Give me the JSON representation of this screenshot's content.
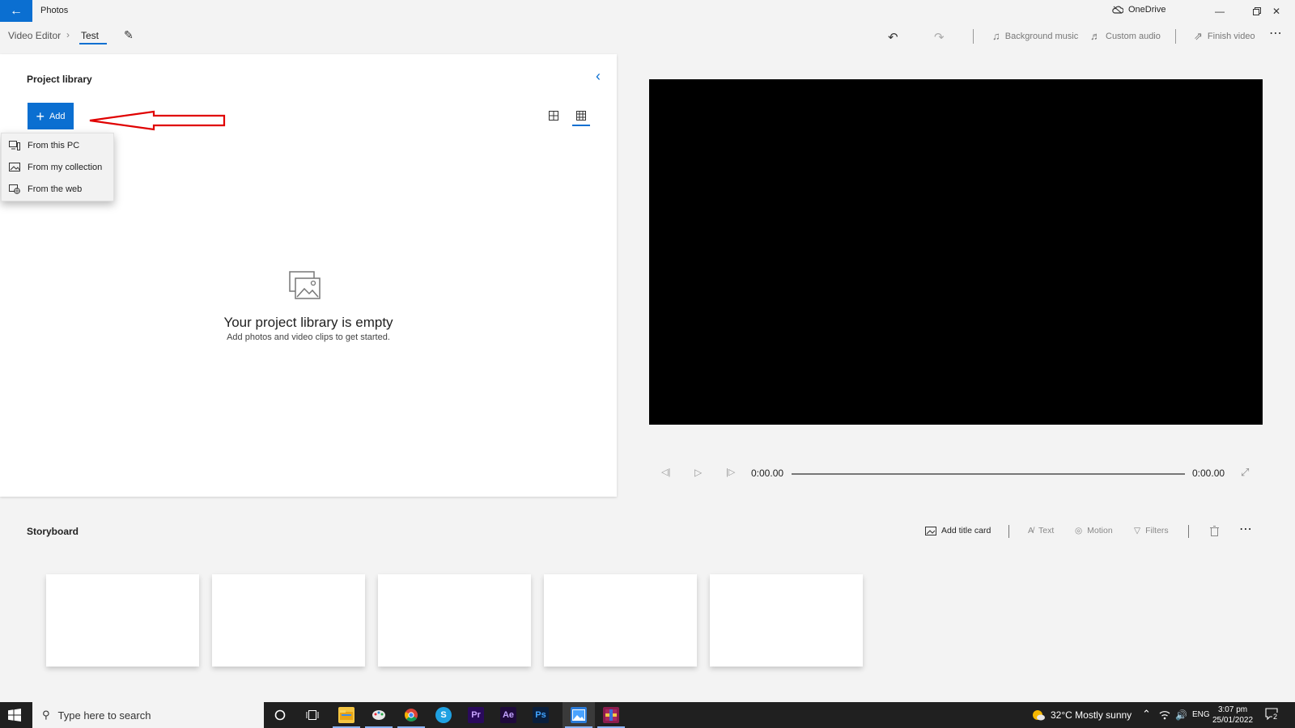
{
  "titlebar": {
    "app_title": "Photos",
    "onedrive_label": "OneDrive",
    "back_icon": "back-arrow-icon",
    "accent_color": "#0b6fd1"
  },
  "cmdbar": {
    "breadcrumb_root": "Video Editor",
    "breadcrumb_current": "Test",
    "tools": {
      "background_music": "Background music",
      "custom_audio": "Custom audio",
      "finish_video": "Finish video"
    }
  },
  "library": {
    "title": "Project library",
    "add_label": "Add",
    "menu": [
      {
        "label": "From this PC",
        "icon": "pc-icon"
      },
      {
        "label": "From my collection",
        "icon": "collection-icon"
      },
      {
        "label": "From the web",
        "icon": "web-icon"
      }
    ],
    "empty_title": "Your project library is empty",
    "empty_subtitle": "Add photos and video clips to get started."
  },
  "player": {
    "current_time": "0:00.00",
    "total_time": "0:00.00",
    "progress_fraction": 0
  },
  "storyboard": {
    "title": "Storyboard",
    "add_title_card": "Add title card",
    "text": "Text",
    "motion": "Motion",
    "filters": "Filters",
    "empty_slots": 5
  },
  "taskbar": {
    "search_placeholder": "Type here to search",
    "weather": "32°C  Mostly sunny",
    "language": "ENG",
    "time": "3:07 pm",
    "date": "25/01/2022",
    "notification_count": "2",
    "apps": [
      {
        "name": "cortana-icon"
      },
      {
        "name": "task-view-icon"
      },
      {
        "name": "file-explorer-icon"
      },
      {
        "name": "paint-icon"
      },
      {
        "name": "chrome-icon"
      },
      {
        "name": "skype-icon",
        "text": "S"
      },
      {
        "name": "premiere-pro-icon",
        "text": "Pr"
      },
      {
        "name": "after-effects-icon",
        "text": "Ae"
      },
      {
        "name": "photoshop-icon",
        "text": "Ps"
      },
      {
        "name": "photos-app-icon"
      },
      {
        "name": "winrar-icon"
      }
    ]
  }
}
